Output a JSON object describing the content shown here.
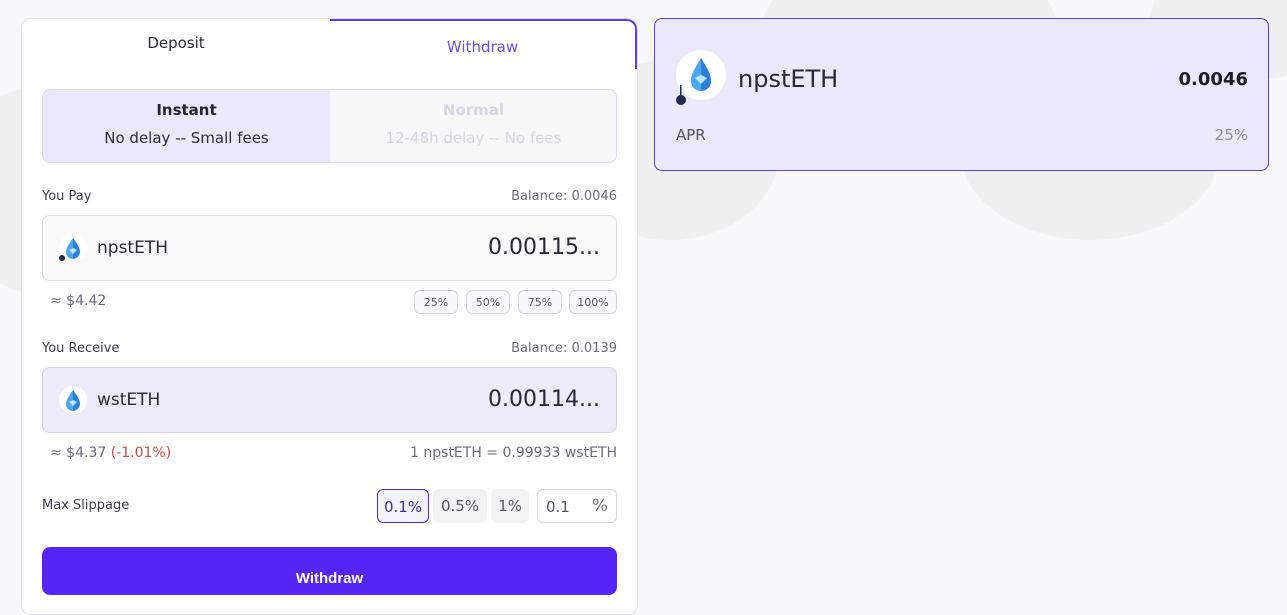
{
  "tabs": {
    "deposit": "Deposit",
    "withdraw": "Withdraw"
  },
  "modes": {
    "instant": {
      "title": "Instant",
      "subtitle": "No delay -- Small fees"
    },
    "normal": {
      "title": "Normal",
      "subtitle": "12-48h delay -- No fees"
    }
  },
  "pay": {
    "label": "You Pay",
    "balance": "Balance: 0.0046",
    "token": "npstETH",
    "token_icon": "water-drop-icon",
    "amount": "0.00115...",
    "usd": "≈ $4.42",
    "percent_buttons": [
      "25%",
      "50%",
      "75%",
      "100%"
    ]
  },
  "receive": {
    "label": "You Receive",
    "balance": "Balance: 0.0139",
    "token": "wstETH",
    "token_icon": "water-drop-icon",
    "amount": "0.00114...",
    "usd": "≈ $4.37",
    "change": "(-1.01%)",
    "rate": "1 npstETH = 0.99933 wstETH"
  },
  "slippage": {
    "label": "Max Slippage",
    "options": [
      "0.1%",
      "0.5%",
      "1%"
    ],
    "selected": "0.1%",
    "custom_value": "0.1",
    "custom_unit": "%"
  },
  "submit_label": "Withdraw",
  "position": {
    "token": "npstETH",
    "balance": "0.0046",
    "apr_label": "APR",
    "apr_value": "25%"
  },
  "colors": {
    "accent": "#5524f6",
    "accent_light": "#ebe8fb",
    "negative": "#d24b47"
  }
}
